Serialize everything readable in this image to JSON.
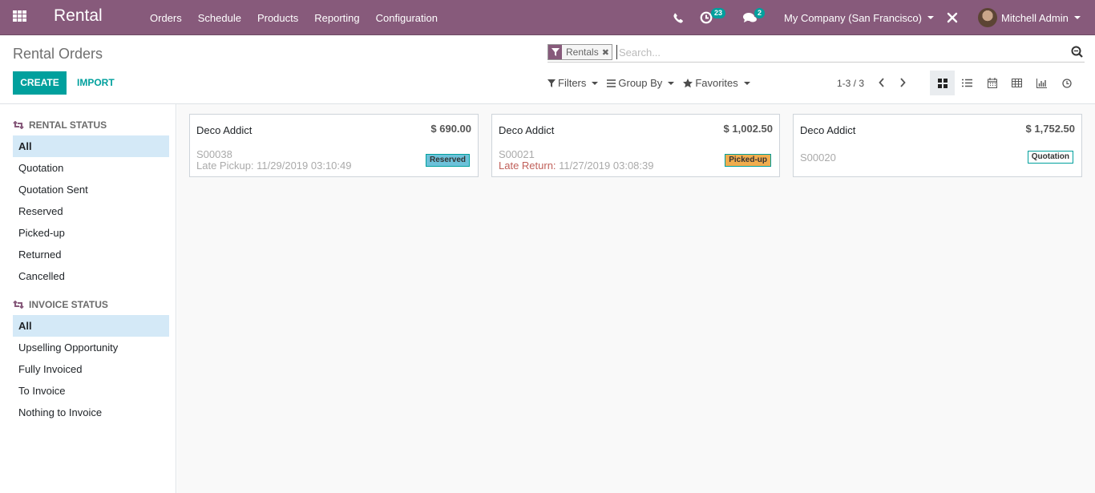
{
  "navbar": {
    "app_name": "Rental",
    "menu": [
      "Orders",
      "Schedule",
      "Products",
      "Reporting",
      "Configuration"
    ],
    "activity_count": "23",
    "messages_count": "2",
    "company": "My Company (San Francisco)",
    "user": "Mitchell Admin"
  },
  "control_panel": {
    "title": "Rental Orders",
    "create_label": "CREATE",
    "import_label": "IMPORT",
    "search": {
      "facet_label": "Rentals",
      "placeholder": "Search...",
      "value": ""
    },
    "filters_label": "Filters",
    "group_by_label": "Group By",
    "favorites_label": "Favorites",
    "pager": "1-3 / 3",
    "views": [
      "kanban",
      "list",
      "calendar",
      "pivot",
      "graph",
      "activity"
    ],
    "active_view": "kanban"
  },
  "sidebar": {
    "rental_status": {
      "header": "RENTAL STATUS",
      "items": [
        "All",
        "Quotation",
        "Quotation Sent",
        "Reserved",
        "Picked-up",
        "Returned",
        "Cancelled"
      ],
      "active": "All"
    },
    "invoice_status": {
      "header": "INVOICE STATUS",
      "items": [
        "All",
        "Upselling Opportunity",
        "Fully Invoiced",
        "To Invoice",
        "Nothing to Invoice"
      ],
      "active": "All"
    }
  },
  "cards": [
    {
      "customer": "Deco Addict",
      "amount": "$ 690.00",
      "reference": "S00038",
      "late_label": "Late Pickup:",
      "late_date": "11/29/2019 03:10:49",
      "late_overdue": false,
      "status": "Reserved",
      "status_color": "#6cc1d9"
    },
    {
      "customer": "Deco Addict",
      "amount": "$ 1,002.50",
      "reference": "S00021",
      "late_label": "Late Return:",
      "late_date": "11/27/2019 03:08:39",
      "late_overdue": true,
      "status": "Picked-up",
      "status_color": "#f0ad4e"
    },
    {
      "customer": "Deco Addict",
      "amount": "$ 1,752.50",
      "reference": "S00020",
      "status": "Quotation",
      "status_color": "#ffffff"
    }
  ],
  "colors": {
    "brand": "#875a7b",
    "accent": "#00a09d",
    "active_filter_bg": "#d4e9f7",
    "overdue": "#c0605a"
  }
}
